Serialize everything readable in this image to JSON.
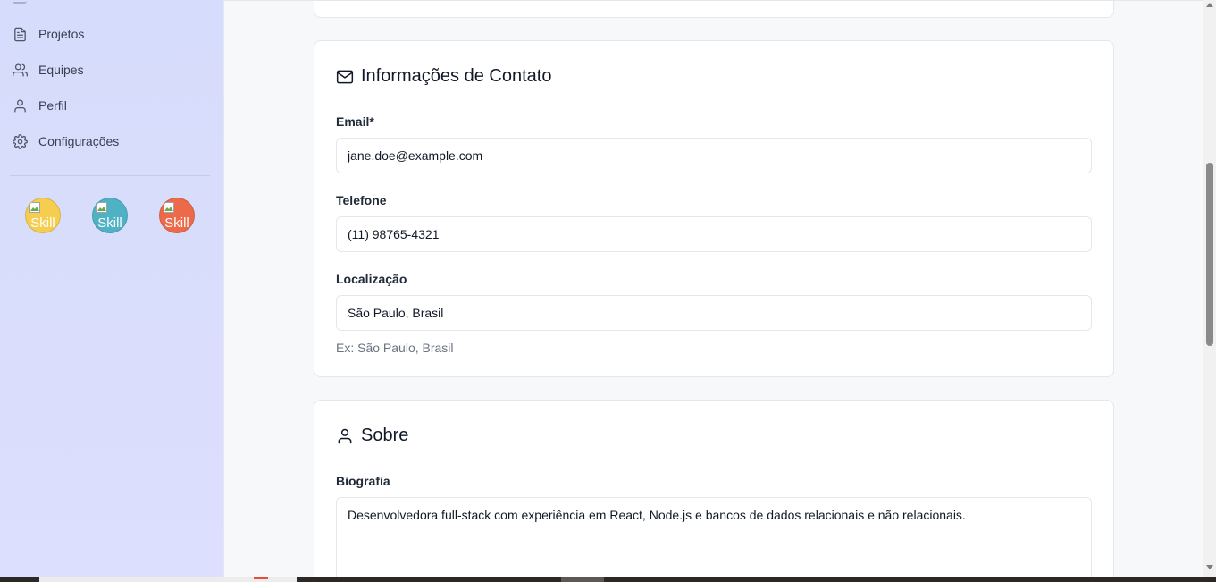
{
  "sidebar": {
    "items": [
      {
        "label": "Projetos",
        "icon": "file-text-icon"
      },
      {
        "label": "Equipes",
        "icon": "users-icon"
      },
      {
        "label": "Perfil",
        "icon": "user-icon"
      },
      {
        "label": "Configurações",
        "icon": "gear-icon"
      }
    ],
    "skills": [
      {
        "alt": "Skill",
        "color": "#f5cd4f"
      },
      {
        "alt": "Skill",
        "color": "#4fb2c4"
      },
      {
        "alt": "Skill",
        "color": "#ec6a4a"
      }
    ]
  },
  "contact": {
    "title": "Informações de Contato",
    "title_icon": "mail-icon",
    "email_label": "Email*",
    "email_value": "jane.doe@example.com",
    "phone_label": "Telefone",
    "phone_value": "(11) 98765-4321",
    "location_label": "Localização",
    "location_value": "São Paulo, Brasil",
    "location_hint": "Ex: São Paulo, Brasil"
  },
  "about": {
    "title": "Sobre",
    "title_icon": "user-icon",
    "bio_label": "Biografia",
    "bio_value": "Desenvolvedora full-stack com experiência em React, Node.js e bancos de dados relacionais e não relacionais."
  },
  "colors": {
    "sidebar_bg": "#d9defc",
    "card_bg": "#ffffff",
    "page_bg": "#f7f8fa"
  }
}
